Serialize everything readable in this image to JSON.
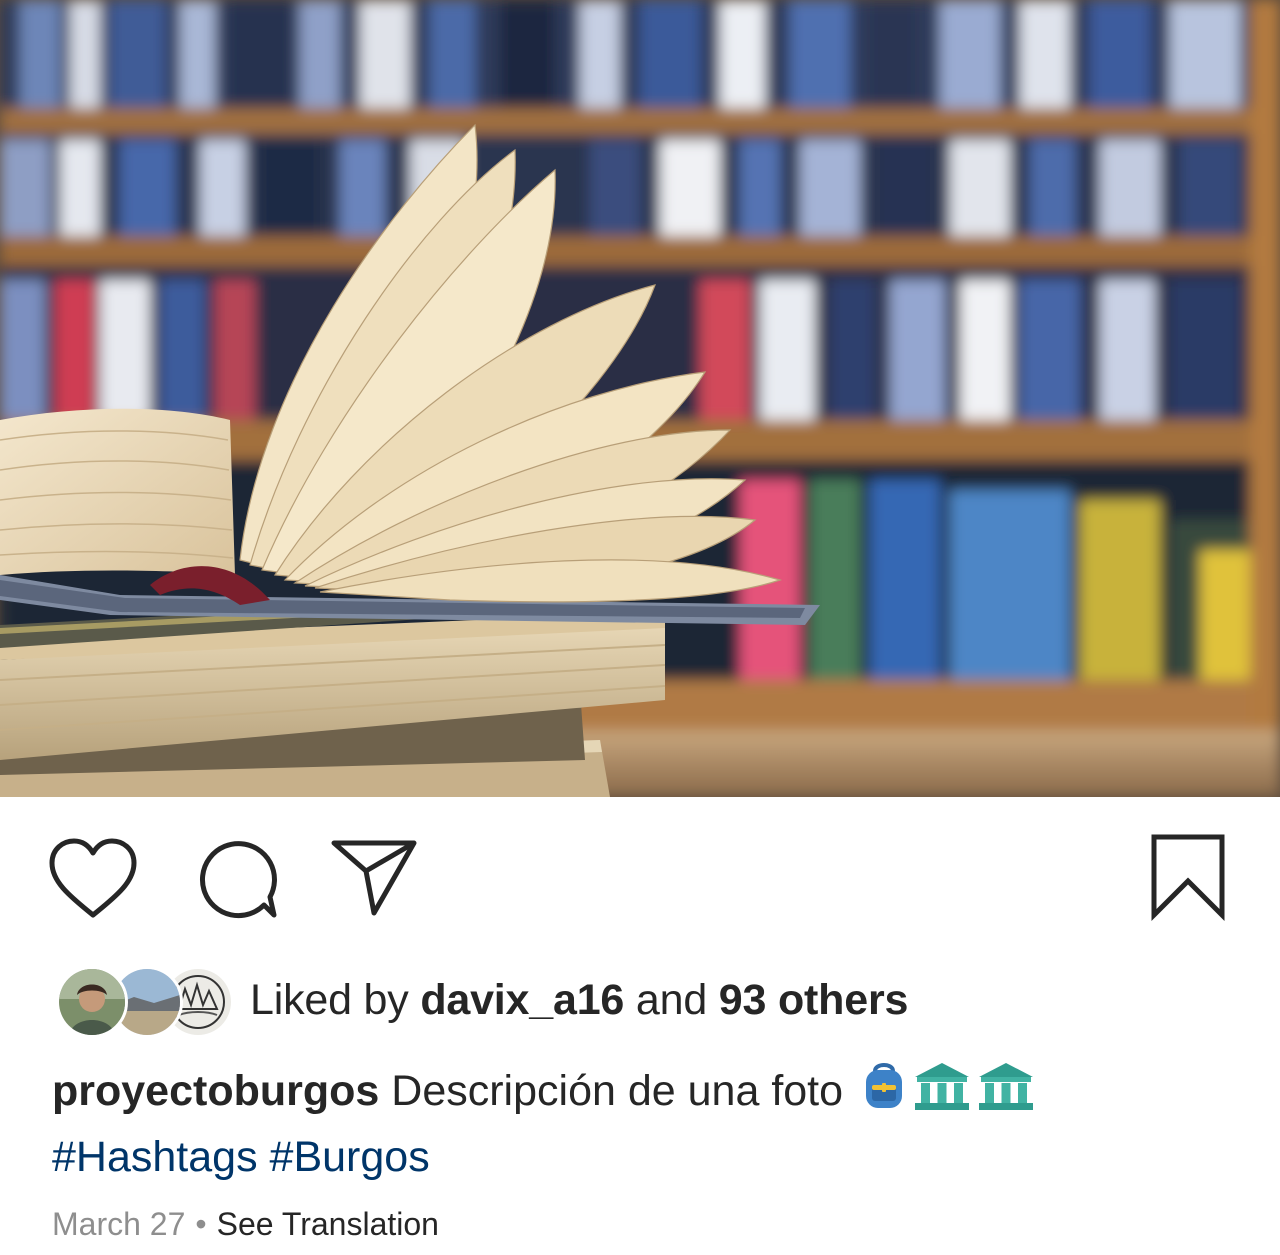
{
  "post": {
    "image_alt": "",
    "liked_by_prefix": "Liked by",
    "liked_by_user": "davix_a16",
    "liked_by_joiner": "and",
    "liked_by_others": "93 others",
    "caption_user": "proyectoburgos",
    "caption_text": "Descripción de una foto",
    "caption_emojis": [
      "backpack-emoji",
      "classical-building-emoji",
      "classical-building-emoji"
    ],
    "hashtags": [
      "#Hashtags",
      "#Burgos"
    ],
    "date": "March 27",
    "separator": "•",
    "see_translation": "See Translation"
  },
  "icons": {
    "like": "heart-icon",
    "comment": "comment-bubble-icon",
    "share": "paper-plane-icon",
    "save": "bookmark-icon"
  },
  "colors": {
    "text": "#262626",
    "hashtag": "#003569",
    "muted": "#8e8e8e",
    "background": "#ffffff"
  }
}
